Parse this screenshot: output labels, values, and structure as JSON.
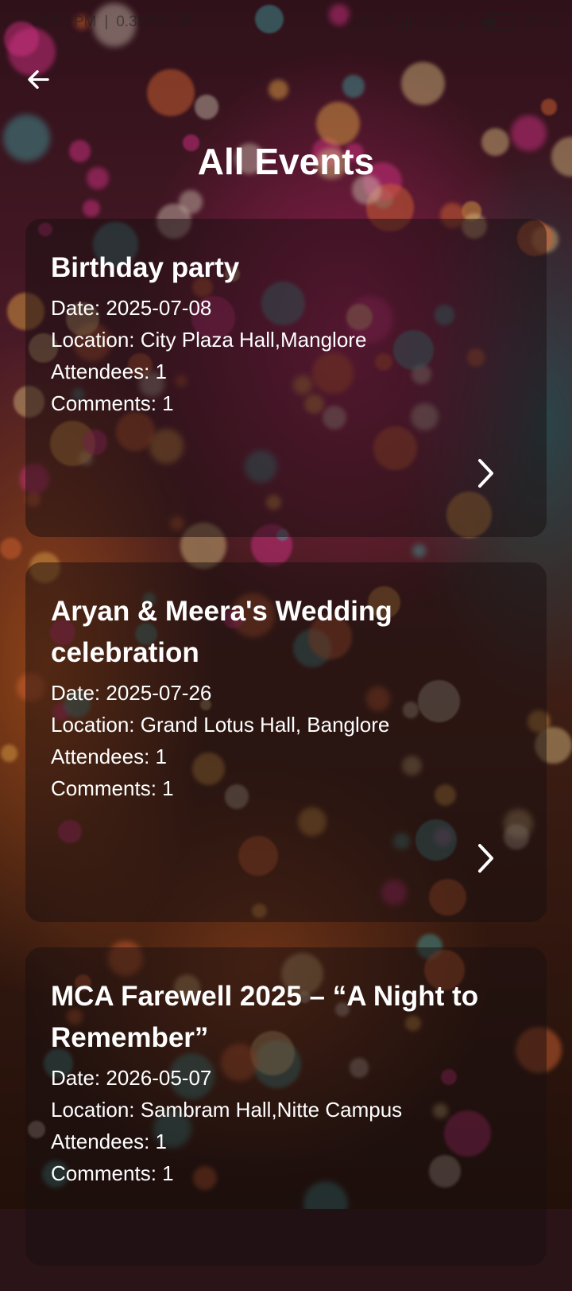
{
  "status_bar": {
    "time": "12:51 PM",
    "speed": "0.3KB/s",
    "more": "···",
    "sim1": "VoLTE",
    "network": "4G",
    "sim2": "VoLTE",
    "battery_percent": "48",
    "battery_level": 0.48
  },
  "header": {
    "back_icon": "arrow-left-icon",
    "title": "All Events"
  },
  "events": [
    {
      "title": "Birthday party",
      "date": "Date: 2025-07-08",
      "location": "Location: City Plaza Hall,Manglore",
      "attendees": "Attendees: 1",
      "comments": "Comments: 1"
    },
    {
      "title": "Aryan & Meera's Wedding celebration",
      "date": "Date: 2025-07-26",
      "location": "Location: Grand Lotus Hall, Banglore",
      "attendees": "Attendees: 1",
      "comments": "Comments: 1"
    },
    {
      "title": "MCA Farewell 2025 – “A Night to Remember”",
      "date": "Date: 2026-05-07",
      "location": "Location: Sambram Hall,Nitte Campus",
      "attendees": "Attendees: 1",
      "comments": "Comments: 1"
    }
  ],
  "icons": {
    "chevron": "chevron-right-icon"
  },
  "colors": {
    "text": "#ffffff",
    "card_bg": "rgba(24,14,16,0.5)"
  }
}
